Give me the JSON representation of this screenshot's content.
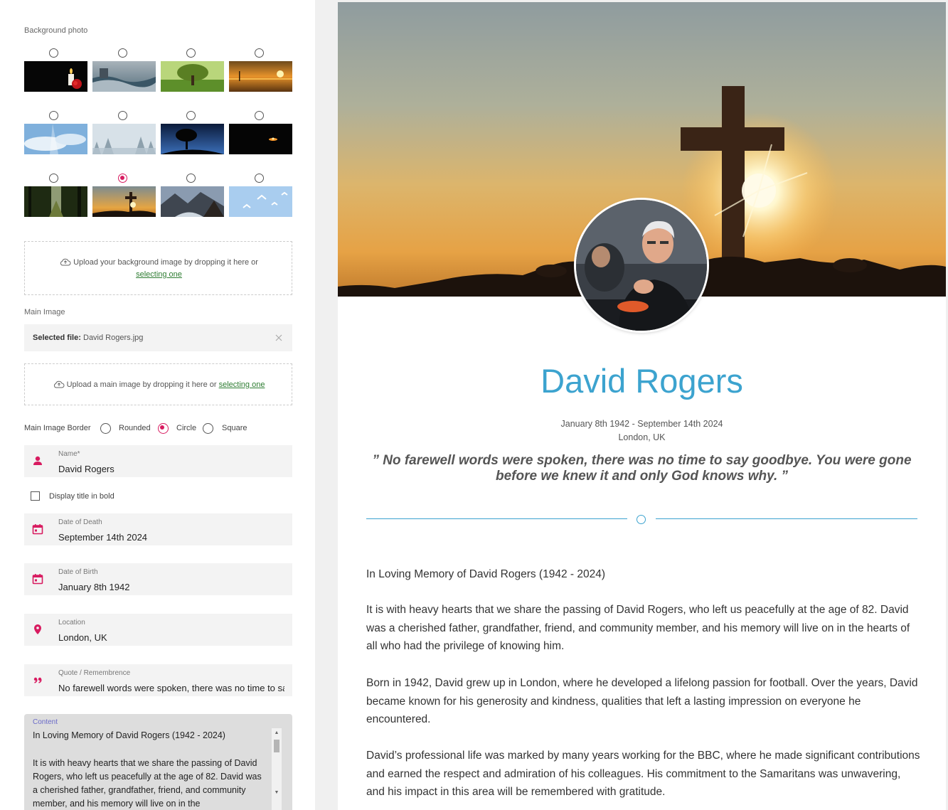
{
  "left": {
    "background_label": "Background photo",
    "backgrounds": [
      {
        "name": "candle-rose",
        "selected": false
      },
      {
        "name": "stormy-sea",
        "selected": false
      },
      {
        "name": "green-tree",
        "selected": false
      },
      {
        "name": "sunset-lake",
        "selected": false
      },
      {
        "name": "sky-clouds",
        "selected": false
      },
      {
        "name": "misty-forest",
        "selected": false
      },
      {
        "name": "tree-night",
        "selected": false
      },
      {
        "name": "dark-candle",
        "selected": false
      },
      {
        "name": "forest-path",
        "selected": false
      },
      {
        "name": "cross-sunset",
        "selected": true
      },
      {
        "name": "mountain-river",
        "selected": false
      },
      {
        "name": "flying-birds",
        "selected": false
      }
    ],
    "bg_upload_text": "Upload your background image by dropping it here or",
    "bg_upload_link": "selecting one",
    "main_image_label": "Main Image",
    "selected_file_label": "Selected file:",
    "selected_file_name": "David Rogers.jpg",
    "main_upload_text": "Upload a main image by dropping it here or",
    "main_upload_link": "selecting one",
    "border_label": "Main Image Border",
    "border_options": [
      "Rounded",
      "Circle",
      "Square"
    ],
    "border_selected": "Circle",
    "name_label": "Name*",
    "name_value": "David Rogers",
    "bold_label": "Display title in bold",
    "bold_checked": false,
    "death_label": "Date of Death",
    "death_value": "September 14th 2024",
    "birth_label": "Date of Birth",
    "birth_value": "January 8th 1942",
    "location_label": "Location",
    "location_value": "London, UK",
    "quote_label": "Quote / Remembrence",
    "quote_value": "No farewell words were spoken, there was no time to say goodbye.",
    "content_label": "Content",
    "content_value": "In Loving Memory of David Rogers (1942 - 2024)\n\nIt is with heavy hearts that we share the passing of David Rogers, who left us peacefully at the age of 82. David was a cherished father, grandfather, friend, and community member, and his memory will live on in the"
  },
  "preview": {
    "name": "David Rogers",
    "dates": "January 8th 1942 - September 14th 2024",
    "location": "London, UK",
    "quote_open": "”",
    "quote_text": "No farewell words were spoken, there was no time to say goodbye. You were gone before we knew it and only God knows why.",
    "quote_close": "”",
    "paragraphs": [
      "In Loving Memory of David Rogers (1942 - 2024)",
      "It is with heavy hearts that we share the passing of David Rogers, who left us peacefully at the age of 82. David was a cherished father, grandfather, friend, and community member, and his memory will live on in the hearts of all who had the privilege of knowing him.",
      "Born in 1942, David grew up in London, where he developed a lifelong passion for football. Over the years, David became known for his generosity and kindness, qualities that left a lasting impression on everyone he encountered.",
      "David’s professional life was marked by many years working for the BBC, where he made significant contributions and earned the respect and admiration of his colleagues. His commitment to the Samaritans was unwavering, and his impact in this area will be remembered with gratitude."
    ]
  },
  "colors": {
    "accent_pink": "#d81b60",
    "accent_blue": "#3ca3cf"
  }
}
